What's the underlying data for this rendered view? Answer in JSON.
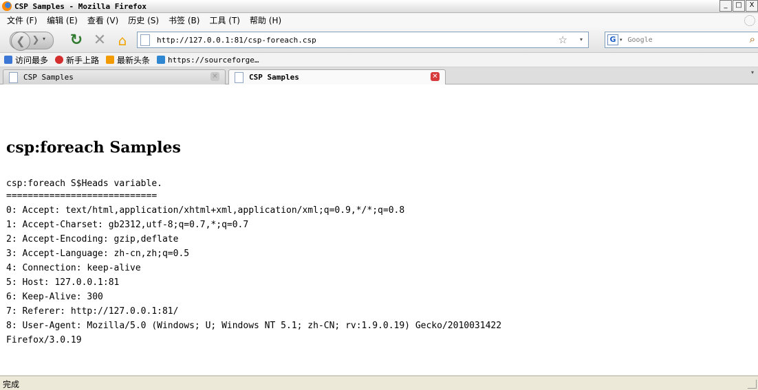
{
  "window": {
    "title": "CSP Samples - Mozilla Firefox",
    "controls": {
      "minimize": "_",
      "maximize": "□",
      "close": "X"
    }
  },
  "menu": {
    "items": [
      "文件 (F)",
      "编辑 (E)",
      "查看 (V)",
      "历史 (S)",
      "书签 (B)",
      "工具 (T)",
      "帮助 (H)"
    ]
  },
  "nav": {
    "url": "http://127.0.0.1:81/csp-foreach.csp",
    "search_placeholder": "Google",
    "icons": {
      "back": "back-arrow-icon",
      "forward": "forward-arrow-icon",
      "reload": "reload-icon",
      "stop": "stop-icon",
      "home": "home-icon",
      "bookmark_star": "star-icon",
      "search_engine": "google-icon",
      "search": "magnifier-icon"
    }
  },
  "bookmarks": {
    "items": [
      {
        "label": "访问最多",
        "icon": "most-visited-icon",
        "color": "#3c77d6"
      },
      {
        "label": "新手上路",
        "icon": "firefox-getting-started-icon",
        "color": "#d42d2d"
      },
      {
        "label": "最新头条",
        "icon": "rss-icon",
        "color": "#f29b00"
      },
      {
        "label": "https://sourceforge…",
        "icon": "sourceforge-icon",
        "color": "#2f86d1"
      }
    ]
  },
  "tabs": [
    {
      "label": "CSP Samples",
      "active": false
    },
    {
      "label": "CSP Samples",
      "active": true
    }
  ],
  "page": {
    "title": "csp:foreach Samples",
    "subtitle": "csp:foreach S$Heads variable.",
    "separator": "============================",
    "lines": [
      "0: Accept: text/html,application/xhtml+xml,application/xml;q=0.9,*/*;q=0.8",
      "1: Accept-Charset: gb2312,utf-8;q=0.7,*;q=0.7",
      "2: Accept-Encoding: gzip,deflate",
      "3: Accept-Language: zh-cn,zh;q=0.5",
      "4: Connection: keep-alive",
      "5: Host: 127.0.0.1:81",
      "6: Keep-Alive: 300",
      "7: Referer: http://127.0.0.1:81/",
      "8: User-Agent: Mozilla/5.0 (Windows; U; Windows NT 5.1; zh-CN; rv:1.9.0.19) Gecko/2010031422",
      "Firefox/3.0.19"
    ]
  },
  "status": {
    "text": "完成"
  }
}
